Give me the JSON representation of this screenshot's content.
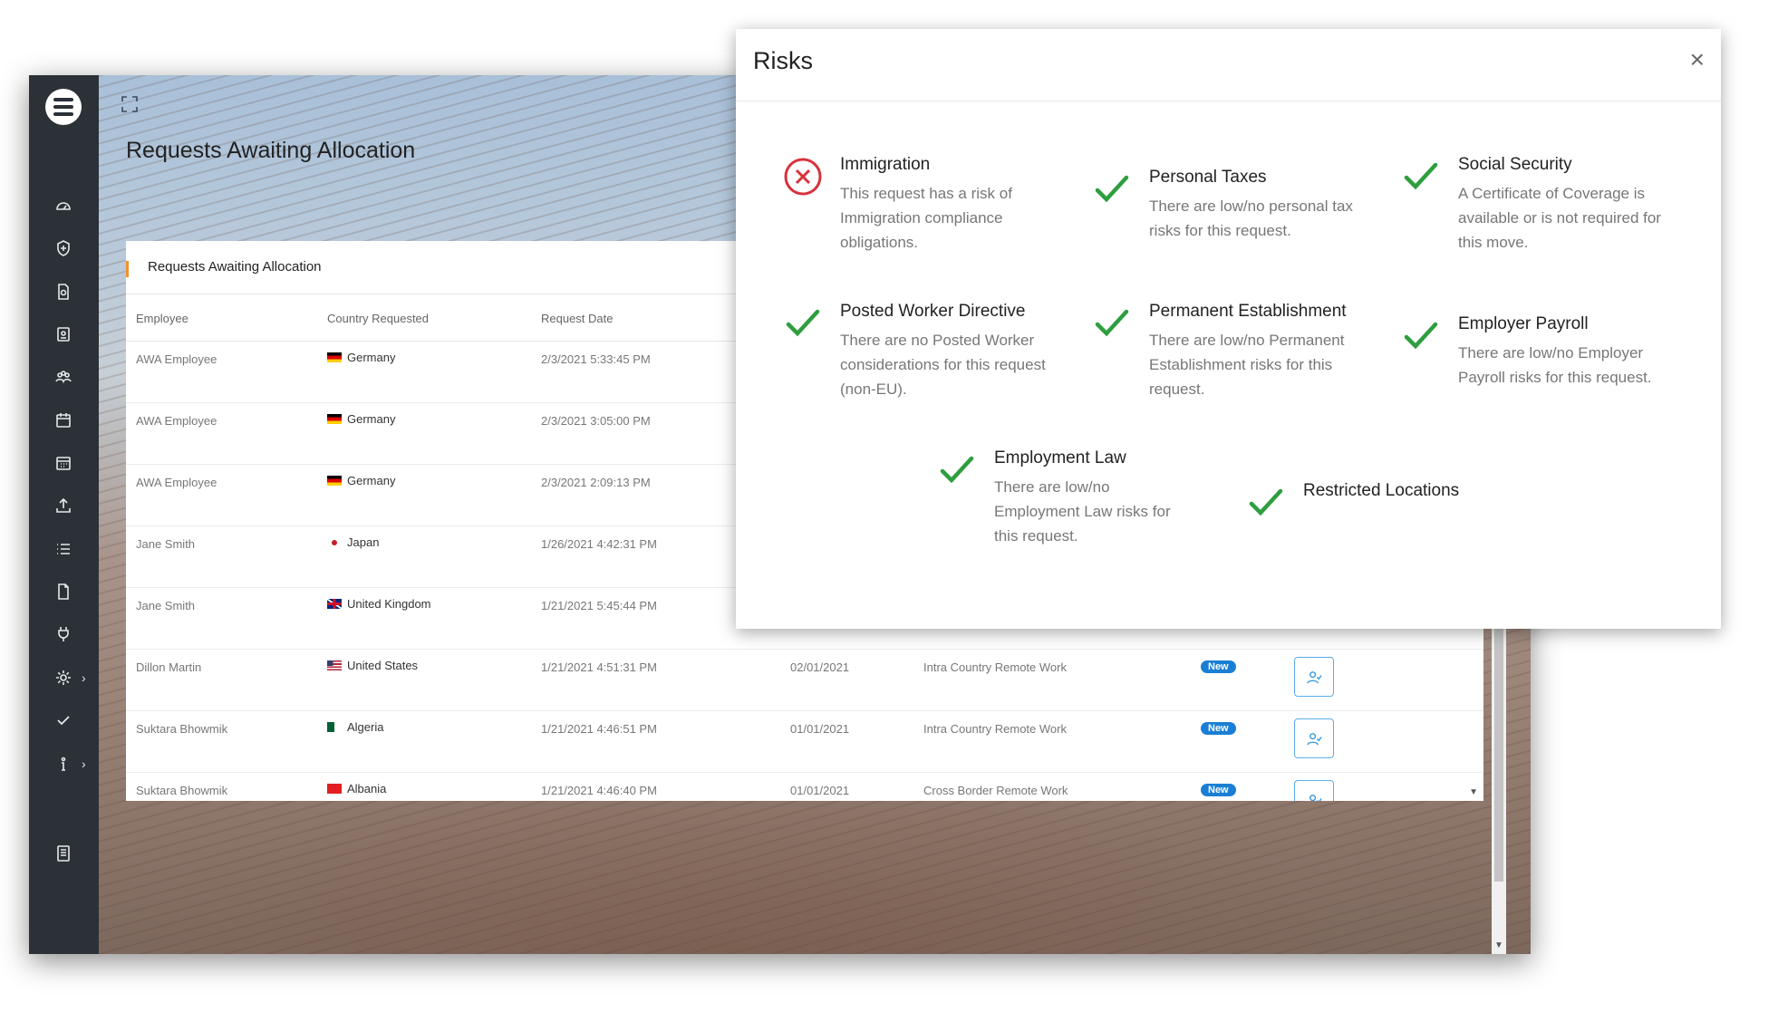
{
  "app": {
    "page_title": "Requests Awaiting Allocation"
  },
  "panel": {
    "title": "Requests Awaiting Allocation",
    "columns": [
      "Employee",
      "Country Requested",
      "Request Date"
    ],
    "rows": [
      {
        "employee": "AWA Employee",
        "country": "Germany",
        "flag": "germany",
        "request_date": "2/3/2021 5:33:45 PM",
        "start": "",
        "type": "",
        "status": ""
      },
      {
        "employee": "AWA Employee",
        "country": "Germany",
        "flag": "germany",
        "request_date": "2/3/2021 3:05:00 PM",
        "start": "",
        "type": "",
        "status": ""
      },
      {
        "employee": "AWA Employee",
        "country": "Germany",
        "flag": "germany",
        "request_date": "2/3/2021 2:09:13 PM",
        "start": "",
        "type": "",
        "status": ""
      },
      {
        "employee": "Jane Smith",
        "country": "Japan",
        "flag": "japan",
        "request_date": "1/26/2021 4:42:31 PM",
        "start": "",
        "type": "",
        "status": ""
      },
      {
        "employee": "Jane Smith",
        "country": "United Kingdom",
        "flag": "uk",
        "request_date": "1/21/2021 5:45:44 PM",
        "start": "",
        "type": "",
        "status": ""
      },
      {
        "employee": "Dillon Martin",
        "country": "United States",
        "flag": "usa",
        "request_date": "1/21/2021 4:51:31 PM",
        "start": "02/01/2021",
        "type": "Intra Country Remote Work",
        "status": "New"
      },
      {
        "employee": "Suktara Bhowmik",
        "country": "Algeria",
        "flag": "algeria",
        "request_date": "1/21/2021 4:46:51 PM",
        "start": "01/01/2021",
        "type": "Intra Country Remote Work",
        "status": "New"
      },
      {
        "employee": "Suktara Bhowmik",
        "country": "Albania",
        "flag": "albania",
        "request_date": "1/21/2021 4:46:40 PM",
        "start": "01/01/2021",
        "type": "Cross Border Remote Work",
        "status": "New"
      }
    ]
  },
  "modal": {
    "title": "Risks",
    "close_label": "×",
    "risks": [
      {
        "title": "Immigration",
        "description": "This request has a risk of Immigration compliance obligations.",
        "status": "risk",
        "icon": "x-circle-icon"
      },
      {
        "title": "Personal Taxes",
        "description": "There are low/no personal tax risks for this request.",
        "status": "ok",
        "icon": "check-icon"
      },
      {
        "title": "Social Security",
        "description": "A Certificate of Coverage is available or is not required for this move.",
        "status": "ok",
        "icon": "check-icon"
      },
      {
        "title": "Posted Worker Directive",
        "description": "There are no Posted Worker considerations for this request (non-EU).",
        "status": "ok",
        "icon": "check-icon"
      },
      {
        "title": "Permanent Establishment",
        "description": "There are low/no Permanent Establishment risks for this request.",
        "status": "ok",
        "icon": "check-icon"
      },
      {
        "title": "Employer Payroll",
        "description": "There are low/no Employer Payroll risks for this request.",
        "status": "ok",
        "icon": "check-icon"
      },
      {
        "title": "Employment Law",
        "description": "There are low/no Employment Law risks for this request.",
        "status": "ok",
        "icon": "check-icon"
      },
      {
        "title": "Restricted Locations",
        "description": "",
        "status": "ok",
        "icon": "check-icon"
      }
    ]
  },
  "colors": {
    "sidebar": "#2b3137",
    "ok_green": "#2e9e3f",
    "risk_red": "#d8323c",
    "accent_orange": "#f0922e",
    "badge_blue": "#1a7fd4"
  },
  "sidebar_icons": [
    "dashboard-icon",
    "shield-icon",
    "document-search-icon",
    "id-card-icon",
    "team-icon",
    "calendar-icon",
    "calendar-grid-icon",
    "upload-icon",
    "list-icon",
    "file-icon",
    "plug-icon",
    "gear-icon",
    "check-icon",
    "info-icon",
    "book-icon"
  ]
}
